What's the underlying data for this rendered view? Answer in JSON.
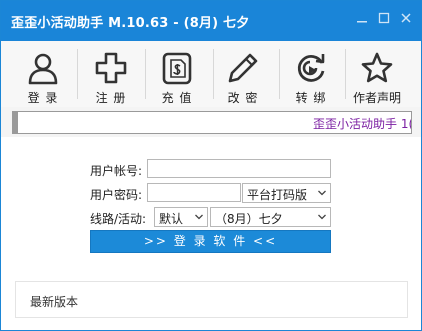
{
  "window": {
    "title": "歪歪小活动助手 M.10.63 - (8月) 七夕",
    "accent_color": "#1a85d8",
    "controls": [
      "minimize-icon",
      "maximize-icon",
      "close-icon"
    ]
  },
  "toolbar": {
    "items": [
      {
        "label": "登 录",
        "icon": "user-icon"
      },
      {
        "label": "注 册",
        "icon": "plus-icon"
      },
      {
        "label": "充 值",
        "icon": "recharge-icon"
      },
      {
        "label": "改 密",
        "icon": "pencil-icon"
      },
      {
        "label": "转 绑",
        "icon": "refresh-icon"
      },
      {
        "label": "作者声明",
        "icon": "star-icon"
      }
    ]
  },
  "marquee": {
    "text": "歪歪小活动助手 1("
  },
  "form": {
    "account_label": "用户帐号:",
    "account_value": "",
    "password_label": "用户密码:",
    "password_value": "",
    "captcha_select": "平台打码版",
    "route_label": "线路/活动:",
    "route_select": "默认",
    "activity_select": "（8月）七夕",
    "login_button": ">> 登 录 软 件 <<"
  },
  "news": {
    "label": "最新版本"
  }
}
